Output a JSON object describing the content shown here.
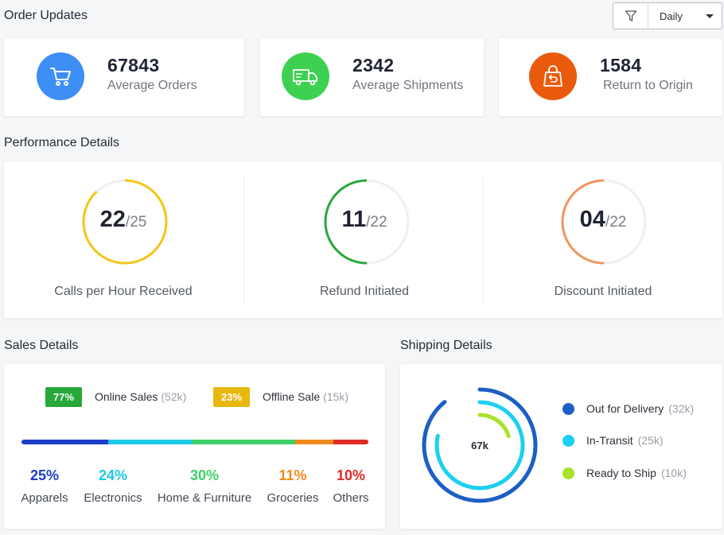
{
  "order_updates": {
    "title": "Order Updates",
    "filter": {
      "selected": "Daily"
    },
    "cards": [
      {
        "value": "67843",
        "label": "Average Orders",
        "color": "#3d8ef5",
        "icon": "cart-icon"
      },
      {
        "value": "2342",
        "label": "Average Shipments",
        "color": "#3dd152",
        "icon": "truck-icon"
      },
      {
        "value": "1584",
        "label": "Return to Origin",
        "color": "#ea5a0c",
        "icon": "return-bag-icon"
      }
    ]
  },
  "performance": {
    "title": "Performance Details",
    "items": [
      {
        "value": "22",
        "total": "/25",
        "label": "Calls per Hour Received",
        "fraction": 0.88,
        "color": "#f5c518"
      },
      {
        "value": "11",
        "total": "/22",
        "label": "Refund Initiated",
        "fraction": 0.5,
        "color": "#27a83a"
      },
      {
        "value": "04",
        "total": "/22",
        "label": "Discount Initiated",
        "fraction": 0.5,
        "color": "#f2955c"
      }
    ]
  },
  "sales": {
    "title": "Sales Details",
    "online": {
      "pct": "77%",
      "label": "Online Sales",
      "amount": "(52k)",
      "color": "#27a83a"
    },
    "offline": {
      "pct": "23%",
      "label": "Offline Sale",
      "amount": "(15k)",
      "color": "#e8b80c"
    },
    "categories": [
      {
        "pct": "25%",
        "name": "Apparels",
        "share": 25,
        "color": "#1d3ec9"
      },
      {
        "pct": "24%",
        "name": "Electronics",
        "share": 24,
        "color": "#1ec8e6"
      },
      {
        "pct": "30%",
        "name": "Home & Furniture",
        "share": 30,
        "color": "#3dd06a"
      },
      {
        "pct": "11%",
        "name": "Groceries",
        "share": 11,
        "color": "#f08a1c"
      },
      {
        "pct": "10%",
        "name": "Others",
        "share": 10,
        "color": "#e02a2a"
      }
    ]
  },
  "shipping": {
    "title": "Shipping Details",
    "center": "67k",
    "items": [
      {
        "label": "Out for Delivery",
        "amount": "(32k)",
        "color": "#1b5fc4"
      },
      {
        "label": "In-Transit",
        "amount": "(25k)",
        "color": "#1cd0f0"
      },
      {
        "label": "Ready to Ship",
        "amount": "(10k)",
        "color": "#a9e22a"
      }
    ]
  }
}
